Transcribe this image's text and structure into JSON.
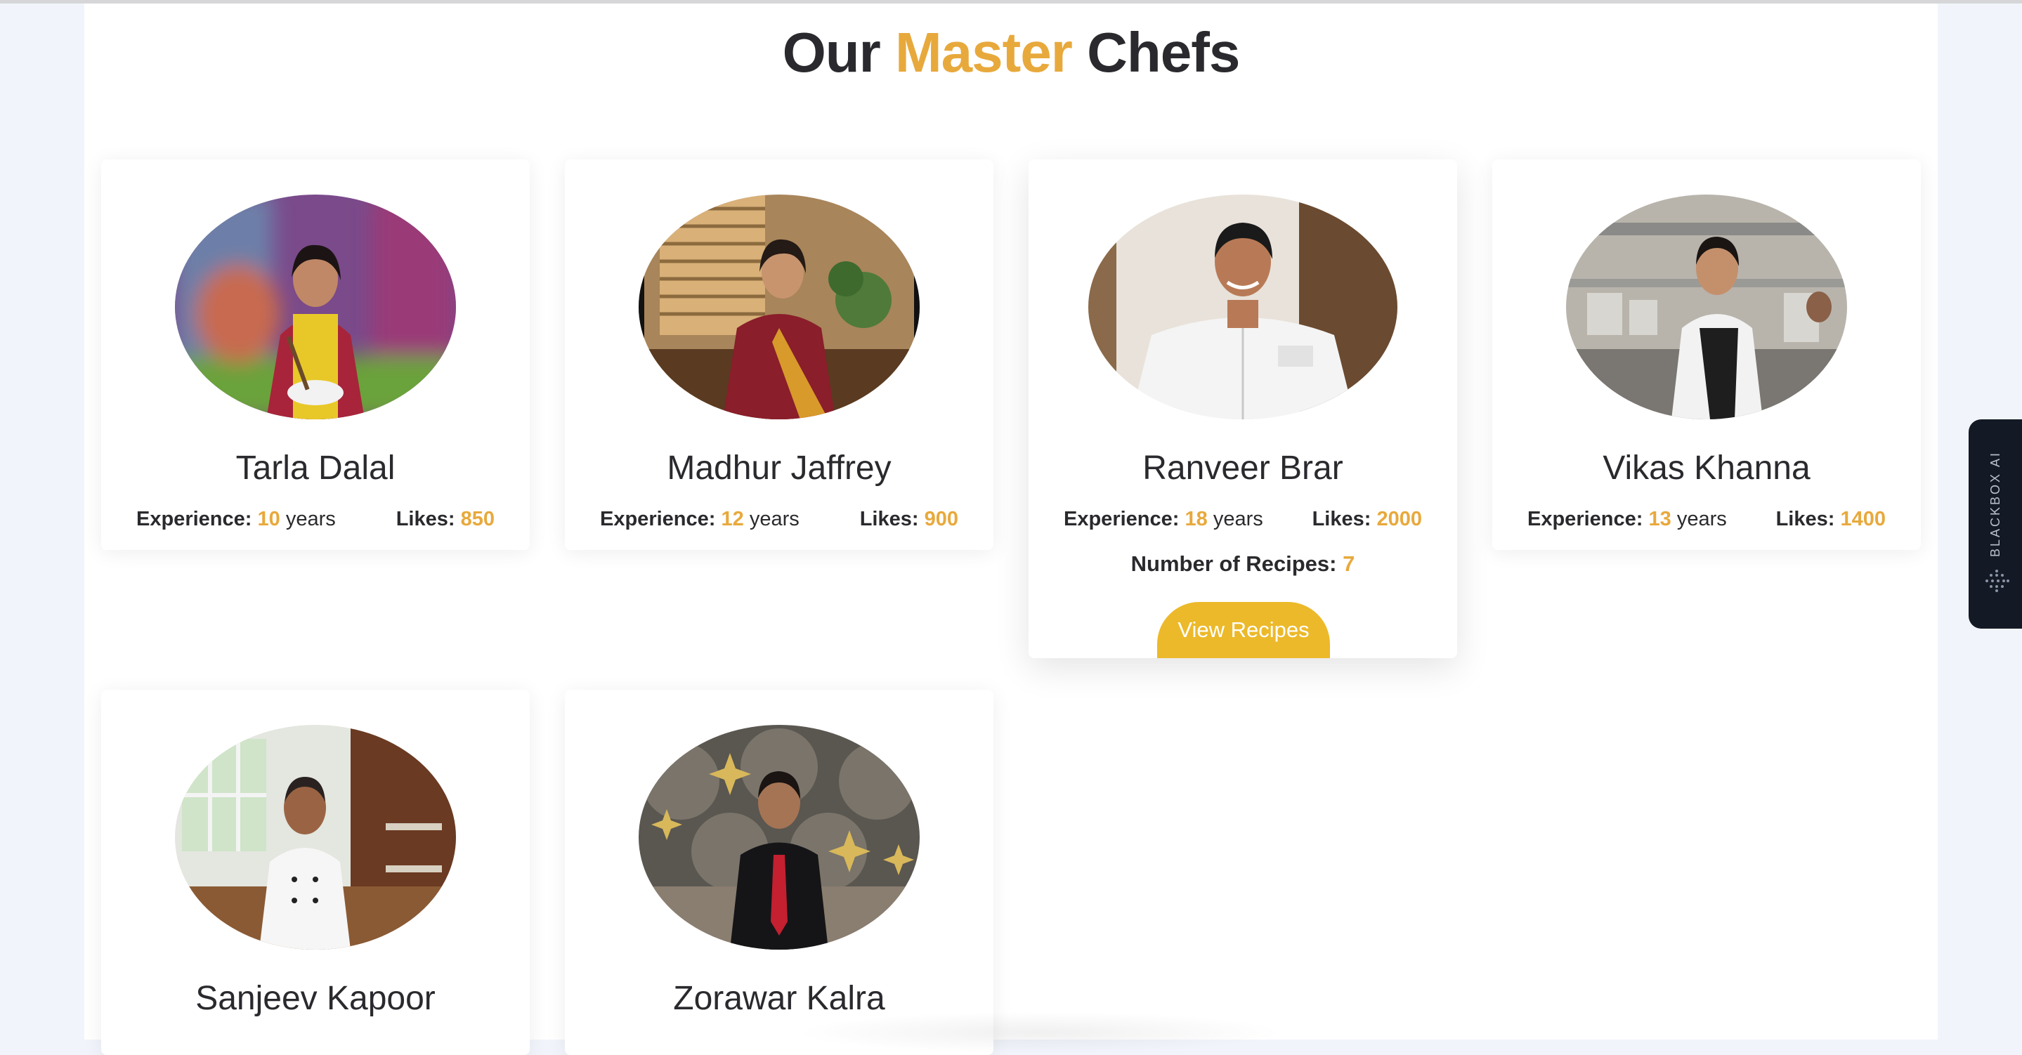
{
  "heading": {
    "prefix": "Our",
    "accent": "Master",
    "suffix": "Chefs"
  },
  "labels": {
    "experience": "Experience:",
    "years": "years",
    "likes": "Likes:",
    "recipes": "Number of Recipes:",
    "view_button": "View Recipes"
  },
  "chefs": [
    {
      "name": "Tarla Dalal",
      "experience": "10",
      "likes": "850"
    },
    {
      "name": "Madhur Jaffrey",
      "experience": "12",
      "likes": "900"
    },
    {
      "name": "Ranveer Brar",
      "experience": "18",
      "likes": "2000",
      "recipes": "7"
    },
    {
      "name": "Vikas Khanna",
      "experience": "13",
      "likes": "1400"
    },
    {
      "name": "Sanjeev Kapoor"
    },
    {
      "name": "Zorawar Kalra"
    }
  ],
  "side_tab": {
    "label": "BLACKBOX AI"
  },
  "colors": {
    "accent": "#e8a93c",
    "button": "#ecb92a",
    "text": "#2a2a2e",
    "page_bg": "#f1f5fb"
  }
}
